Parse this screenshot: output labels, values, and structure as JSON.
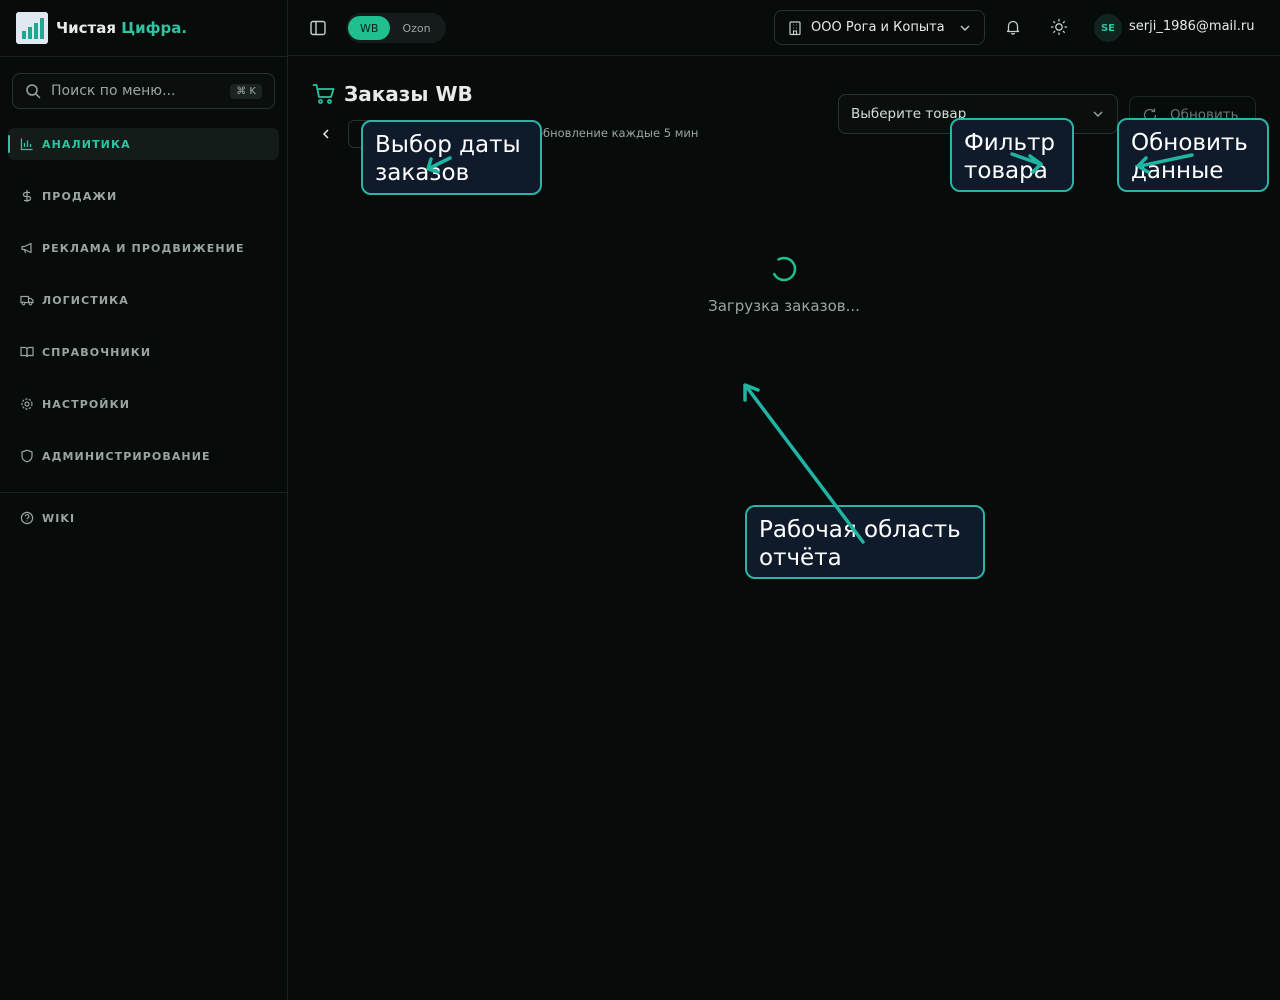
{
  "brand": {
    "name_main": "Чистая",
    "name_accent": "Цифра",
    "name_dot": "."
  },
  "sidebar": {
    "search_placeholder": "Поиск по меню...",
    "search_shortcut": "⌘ K",
    "items": [
      {
        "label": "АНАЛИТИКА",
        "icon": "bar-chart-icon",
        "active": true
      },
      {
        "label": "ПРОДАЖИ",
        "icon": "dollar-icon"
      },
      {
        "label": "РЕКЛАМА И ПРОДВИЖЕНИЕ",
        "icon": "megaphone-icon"
      },
      {
        "label": "ЛОГИСТИКА",
        "icon": "truck-icon"
      },
      {
        "label": "СПРАВОЧНИКИ",
        "icon": "book-icon"
      },
      {
        "label": "НАСТРОЙКИ",
        "icon": "gear-icon"
      },
      {
        "label": "АДМИНИСТРИРОВАНИЕ",
        "icon": "shield-icon"
      }
    ],
    "footer_items": [
      {
        "label": "WIKI",
        "icon": "help-circle-icon"
      }
    ]
  },
  "topbar": {
    "marketplaces": [
      "WB",
      "Ozon"
    ],
    "marketplace_selected": "WB",
    "company": "ООО Рога и Копыта",
    "avatar_initials": "SE",
    "user_email": "serji_1986@mail.ru"
  },
  "main": {
    "title": "Заказы WB",
    "refresh_note": "обновление каждые 5 мин",
    "product_select_placeholder": "Выберите товар",
    "refresh_button": "Обновить",
    "loading_text": "Загрузка заказов..."
  },
  "callouts": {
    "date": "Выбор даты\nзаказов",
    "product": "Фильтр\nтовара",
    "refresh": "Обновить\nданные",
    "workspace": "Рабочая область\nотчёта"
  },
  "colors": {
    "accent": "#2fc3a2",
    "background": "#070b0a",
    "callout_border": "#29b4a4",
    "callout_bg": "#0f1a2b"
  }
}
